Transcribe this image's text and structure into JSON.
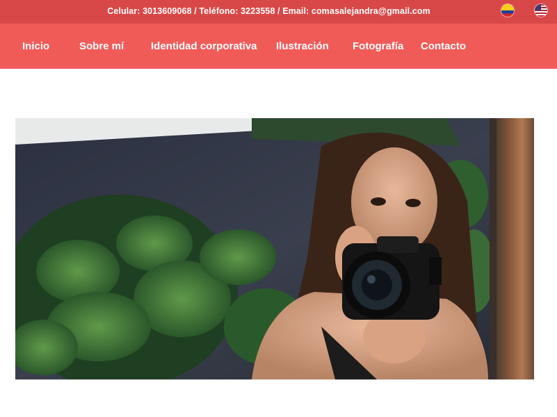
{
  "topbar": {
    "contact_text": "Celular: 3013609068 / Teléfono: 3223558 / Email: comasalejandra@gmail.com",
    "flags": [
      "colombia-flag-icon",
      "usa-flag-icon"
    ]
  },
  "nav": {
    "items": [
      {
        "label": "Inicio"
      },
      {
        "label": "Sobre mí"
      },
      {
        "label": "Identidad corporativa"
      },
      {
        "label": "Ilustración"
      },
      {
        "label": "Fotografía"
      },
      {
        "label": "Contacto"
      }
    ]
  },
  "colors": {
    "topbar": "#d94848",
    "navbar": "#f05b58",
    "text": "#ffffff"
  },
  "hero": {
    "image": "photo of a woman holding a camera reflected in a mirror with tropical plants"
  }
}
